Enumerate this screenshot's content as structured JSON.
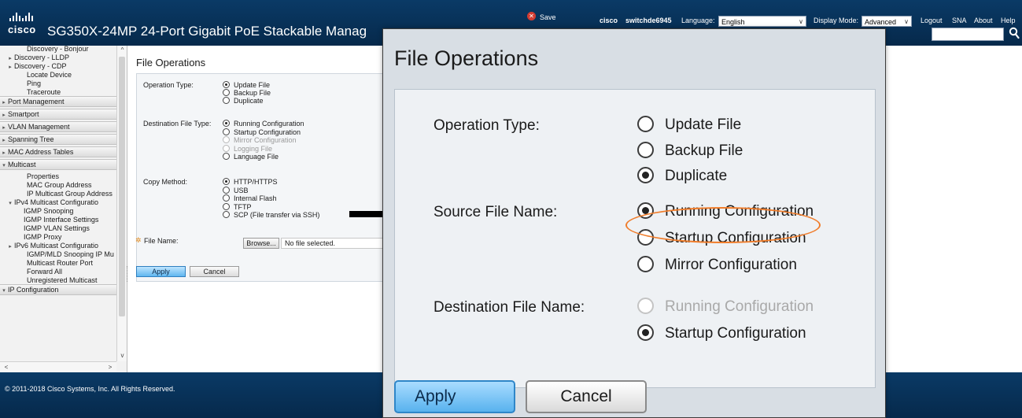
{
  "header": {
    "brand": "cisco",
    "title": "SG350X-24MP 24-Port Gigabit PoE Stackable Manag",
    "save_label": "Save",
    "username": "cisco",
    "hostname": "switchde6945",
    "language_label": "Language:",
    "language_value": "English",
    "display_mode_label": "Display Mode:",
    "display_mode_value": "Advanced",
    "logout": "Logout",
    "sna": "SNA",
    "about": "About",
    "help": "Help"
  },
  "nav": {
    "items": [
      {
        "label": "Discovery - Bonjour",
        "type": "item",
        "arrow": ""
      },
      {
        "label": "Discovery - LLDP",
        "type": "item",
        "arrow": "▸"
      },
      {
        "label": "Discovery - CDP",
        "type": "item",
        "arrow": "▸"
      },
      {
        "label": "Locate Device",
        "type": "item",
        "arrow": ""
      },
      {
        "label": "Ping",
        "type": "item",
        "arrow": ""
      },
      {
        "label": "Traceroute",
        "type": "item",
        "arrow": ""
      },
      {
        "label": "Port Management",
        "type": "section",
        "arrow": "▸"
      },
      {
        "label": "Smartport",
        "type": "section",
        "arrow": "▸"
      },
      {
        "label": "VLAN Management",
        "type": "section",
        "arrow": "▸"
      },
      {
        "label": "Spanning Tree",
        "type": "section",
        "arrow": "▸"
      },
      {
        "label": "MAC Address Tables",
        "type": "section",
        "arrow": "▸"
      },
      {
        "label": "Multicast",
        "type": "section",
        "arrow": "▾"
      },
      {
        "label": "Properties",
        "type": "item",
        "arrow": ""
      },
      {
        "label": "MAC Group Address",
        "type": "item",
        "arrow": ""
      },
      {
        "label": "IP Multicast Group Address",
        "type": "item",
        "arrow": ""
      },
      {
        "label": "IPv4 Multicast Configuratio",
        "type": "item",
        "arrow": "▾"
      },
      {
        "label": "IGMP Snooping",
        "type": "sub",
        "arrow": ""
      },
      {
        "label": "IGMP Interface Settings",
        "type": "sub",
        "arrow": ""
      },
      {
        "label": "IGMP VLAN Settings",
        "type": "sub",
        "arrow": ""
      },
      {
        "label": "IGMP Proxy",
        "type": "sub",
        "arrow": ""
      },
      {
        "label": "IPv6 Multicast Configuratio",
        "type": "item",
        "arrow": "▸"
      },
      {
        "label": "IGMP/MLD Snooping IP Mu",
        "type": "item",
        "arrow": ""
      },
      {
        "label": "Multicast Router Port",
        "type": "item",
        "arrow": ""
      },
      {
        "label": "Forward All",
        "type": "item",
        "arrow": ""
      },
      {
        "label": "Unregistered Multicast",
        "type": "item",
        "arrow": ""
      },
      {
        "label": "IP Configuration",
        "type": "section",
        "arrow": "▾"
      }
    ]
  },
  "main": {
    "title": "File Operations",
    "operation_type_label": "Operation Type:",
    "operation_options": [
      {
        "label": "Update File",
        "selected": true,
        "disabled": false
      },
      {
        "label": "Backup File",
        "selected": false,
        "disabled": false
      },
      {
        "label": "Duplicate",
        "selected": false,
        "disabled": false
      }
    ],
    "dest_file_type_label": "Destination File Type:",
    "dest_options": [
      {
        "label": "Running Configuration",
        "selected": true,
        "disabled": false
      },
      {
        "label": "Startup Configuration",
        "selected": false,
        "disabled": false
      },
      {
        "label": "Mirror Configuration",
        "selected": false,
        "disabled": true
      },
      {
        "label": "Logging File",
        "selected": false,
        "disabled": true
      },
      {
        "label": "Language File",
        "selected": false,
        "disabled": false
      }
    ],
    "copy_method_label": "Copy Method:",
    "copy_options": [
      {
        "label": "HTTP/HTTPS",
        "selected": true,
        "disabled": false
      },
      {
        "label": "USB",
        "selected": false,
        "disabled": false
      },
      {
        "label": "Internal Flash",
        "selected": false,
        "disabled": false
      },
      {
        "label": "TFTP",
        "selected": false,
        "disabled": false
      },
      {
        "label": "SCP (File transfer via SSH)",
        "selected": false,
        "disabled": false
      }
    ],
    "file_name_label": "File Name:",
    "browse_label": "Browse...",
    "file_value": "No file selected.",
    "apply_label": "Apply",
    "cancel_label": "Cancel"
  },
  "footer": {
    "copyright": "© 2011-2018 Cisco Systems, Inc. All Rights Reserved."
  },
  "zoom": {
    "title": "File Operations",
    "operation_type_label": "Operation Type:",
    "operation_options": [
      {
        "label": "Update File",
        "selected": false,
        "disabled": false
      },
      {
        "label": "Backup File",
        "selected": false,
        "disabled": false
      },
      {
        "label": "Duplicate",
        "selected": true,
        "disabled": false
      }
    ],
    "source_file_label": "Source File Name:",
    "source_options": [
      {
        "label": "Running Configuration",
        "selected": true,
        "disabled": false
      },
      {
        "label": "Startup Configuration",
        "selected": false,
        "disabled": false
      },
      {
        "label": "Mirror Configuration",
        "selected": false,
        "disabled": false
      }
    ],
    "dest_file_label": "Destination File Name:",
    "dest_options": [
      {
        "label": "Running Configuration",
        "selected": false,
        "disabled": true
      },
      {
        "label": "Startup Configuration",
        "selected": true,
        "disabled": false
      }
    ],
    "apply_label": "Apply",
    "cancel_label": "Cancel",
    "highlight_color": "#f07d2b"
  },
  "colors": {
    "header_bg": "#06294b",
    "apply_blue": "#58b2ee",
    "save_red": "#d23c32",
    "required_orange": "#e08a1e"
  }
}
